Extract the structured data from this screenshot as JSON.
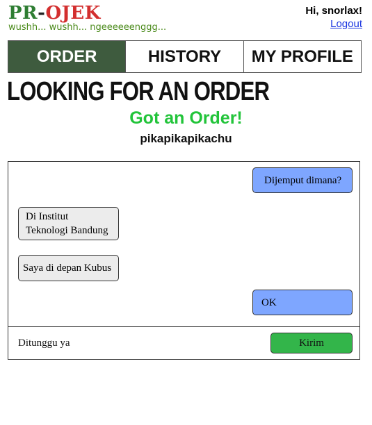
{
  "header": {
    "logo": {
      "pr": "PR",
      "dash": "-",
      "ojek": "OJEK"
    },
    "tagline": "wushh... wushh... ngeeeeeenggg...",
    "greeting": "Hi, snorlax!",
    "logout_label": "Logout"
  },
  "nav": {
    "tabs": [
      {
        "label": "ORDER",
        "active": true
      },
      {
        "label": "HISTORY",
        "active": false
      },
      {
        "label": "MY PROFILE",
        "active": false
      }
    ]
  },
  "main": {
    "heading": "LOOKING FOR AN ORDER",
    "status": "Got an Order!",
    "customer_name": "pikapikapikachu"
  },
  "chat": {
    "messages": [
      {
        "sender": "driver",
        "text": "Dijemput dimana?"
      },
      {
        "sender": "customer",
        "text": "Di Institut Teknologi Bandung"
      },
      {
        "sender": "customer",
        "text": "Saya di depan Kubus"
      },
      {
        "sender": "driver",
        "text": "OK"
      }
    ],
    "input_value": "Ditunggu ya",
    "send_label": "Kirim"
  },
  "colors": {
    "active_tab": "#3e5b3e",
    "status_green": "#22c43a",
    "driver_bubble": "#7ea6ff",
    "customer_bubble": "#ececec",
    "send_button": "#33b54a"
  }
}
